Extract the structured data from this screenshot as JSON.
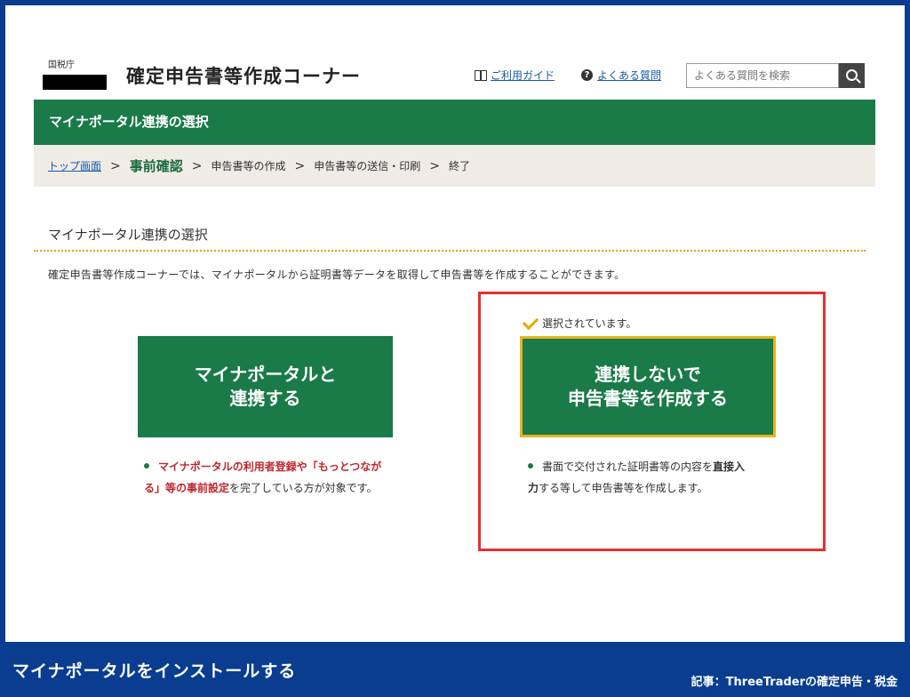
{
  "header": {
    "agency": "国税庁",
    "title": "確定申告書等作成コーナー",
    "guide_link": "ご利用ガイド",
    "faq_link": "よくある質問",
    "search_placeholder": "よくある質問を検索",
    "faq_icon_glyph": "?"
  },
  "page_title": "マイナポータル連携の選択",
  "breadcrumb": {
    "items": [
      "トップ画面",
      "事前確認",
      "申告書等の作成",
      "申告書等の送信・印刷",
      "終了"
    ],
    "separator": ">"
  },
  "section": {
    "heading": "マイナポータル連携の選択",
    "description": "確定申告書等作成コーナーでは、マイナポータルから証明書等データを取得して申告書等を作成することができます。"
  },
  "options": {
    "link": {
      "line1": "マイナポータルと",
      "line2": "連携する",
      "note_red": "マイナポータルの利用者登録や「もっとつながる」等の事前設定",
      "note_rest": "を完了している方が対象です。"
    },
    "no_link": {
      "selected_label": "選択されています。",
      "line1": "連携しないで",
      "line2": "申告書等を作成する",
      "note_pre": "書面で交付された証明書等の内容を",
      "note_bold": "直接入力",
      "note_post": "する等して申告書等を作成します。"
    }
  },
  "footer": {
    "left": "マイナポータルをインストールする",
    "right": "記事：ThreeTraderの確定申告・税金"
  },
  "colors": {
    "brand_green": "#1a7a48",
    "frame_blue": "#0a3d8f",
    "highlight_red": "#e53030",
    "selected_gold": "#e8b420"
  },
  "icons": {
    "guide": "book-icon",
    "faq": "question-circle-icon",
    "search": "search-icon",
    "selected": "check-icon"
  }
}
